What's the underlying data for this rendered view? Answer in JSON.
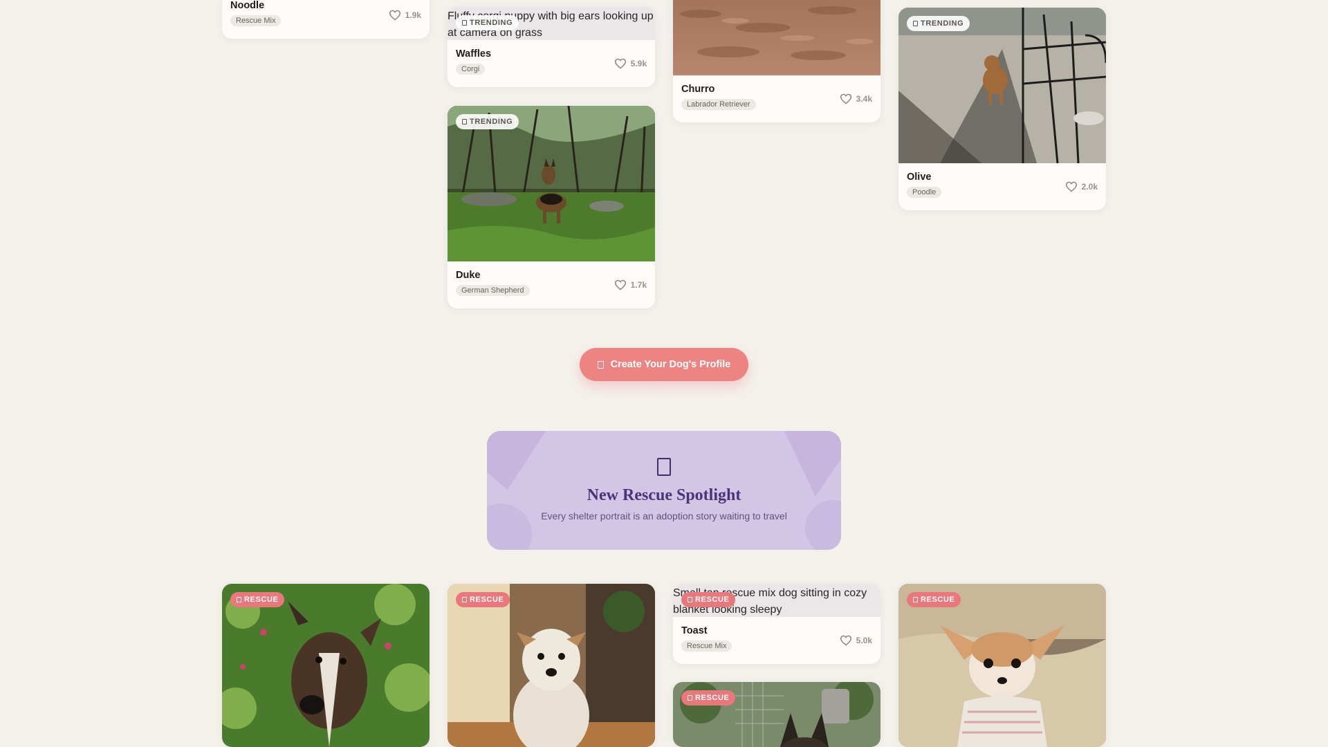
{
  "cards": {
    "noodle": {
      "name": "Noodle",
      "breed": "Rescue Mix",
      "likes": "1.9k"
    },
    "waffles": {
      "name": "Waffles",
      "breed": "Corgi",
      "likes": "5.9k",
      "badge": "TRENDING",
      "image_alt": "Fluffy corgi puppy with big ears looking up at camera on grass"
    },
    "duke": {
      "name": "Duke",
      "breed": "German Shepherd",
      "likes": "1.7k",
      "badge": "TRENDING"
    },
    "churro": {
      "name": "Churro",
      "breed": "Labrador Retriever",
      "likes": "3.4k"
    },
    "olive": {
      "name": "Olive",
      "breed": "Poodle",
      "likes": "2.0k",
      "badge": "TRENDING"
    },
    "brindle": {
      "badge": "RESCUE"
    },
    "terrier": {
      "badge": "RESCUE"
    },
    "toast": {
      "name": "Toast",
      "breed": "Rescue Mix",
      "likes": "5.0k",
      "badge": "RESCUE",
      "image_alt": "Small tan rescue mix dog sitting in cozy blanket looking sleepy"
    },
    "shepherd_pup": {
      "badge": "RESCUE"
    },
    "chihuahua": {
      "badge": "RESCUE"
    }
  },
  "cta": {
    "label": "Create Your Dog's Profile"
  },
  "spotlight": {
    "title": "New Rescue Spotlight",
    "subtitle": "Every shelter portrait is an adoption story waiting to travel"
  },
  "colors": {
    "background": "#f4f1ec",
    "accent": "#ec8483",
    "rescue_badge": "#e8787c",
    "spotlight_bg": "#d2c5e5",
    "spotlight_title": "#4a3477"
  },
  "icons": {
    "like": "heart-icon",
    "badge": "badge-icon",
    "cta": "paw-icon",
    "spotlight": "shelter-icon"
  }
}
